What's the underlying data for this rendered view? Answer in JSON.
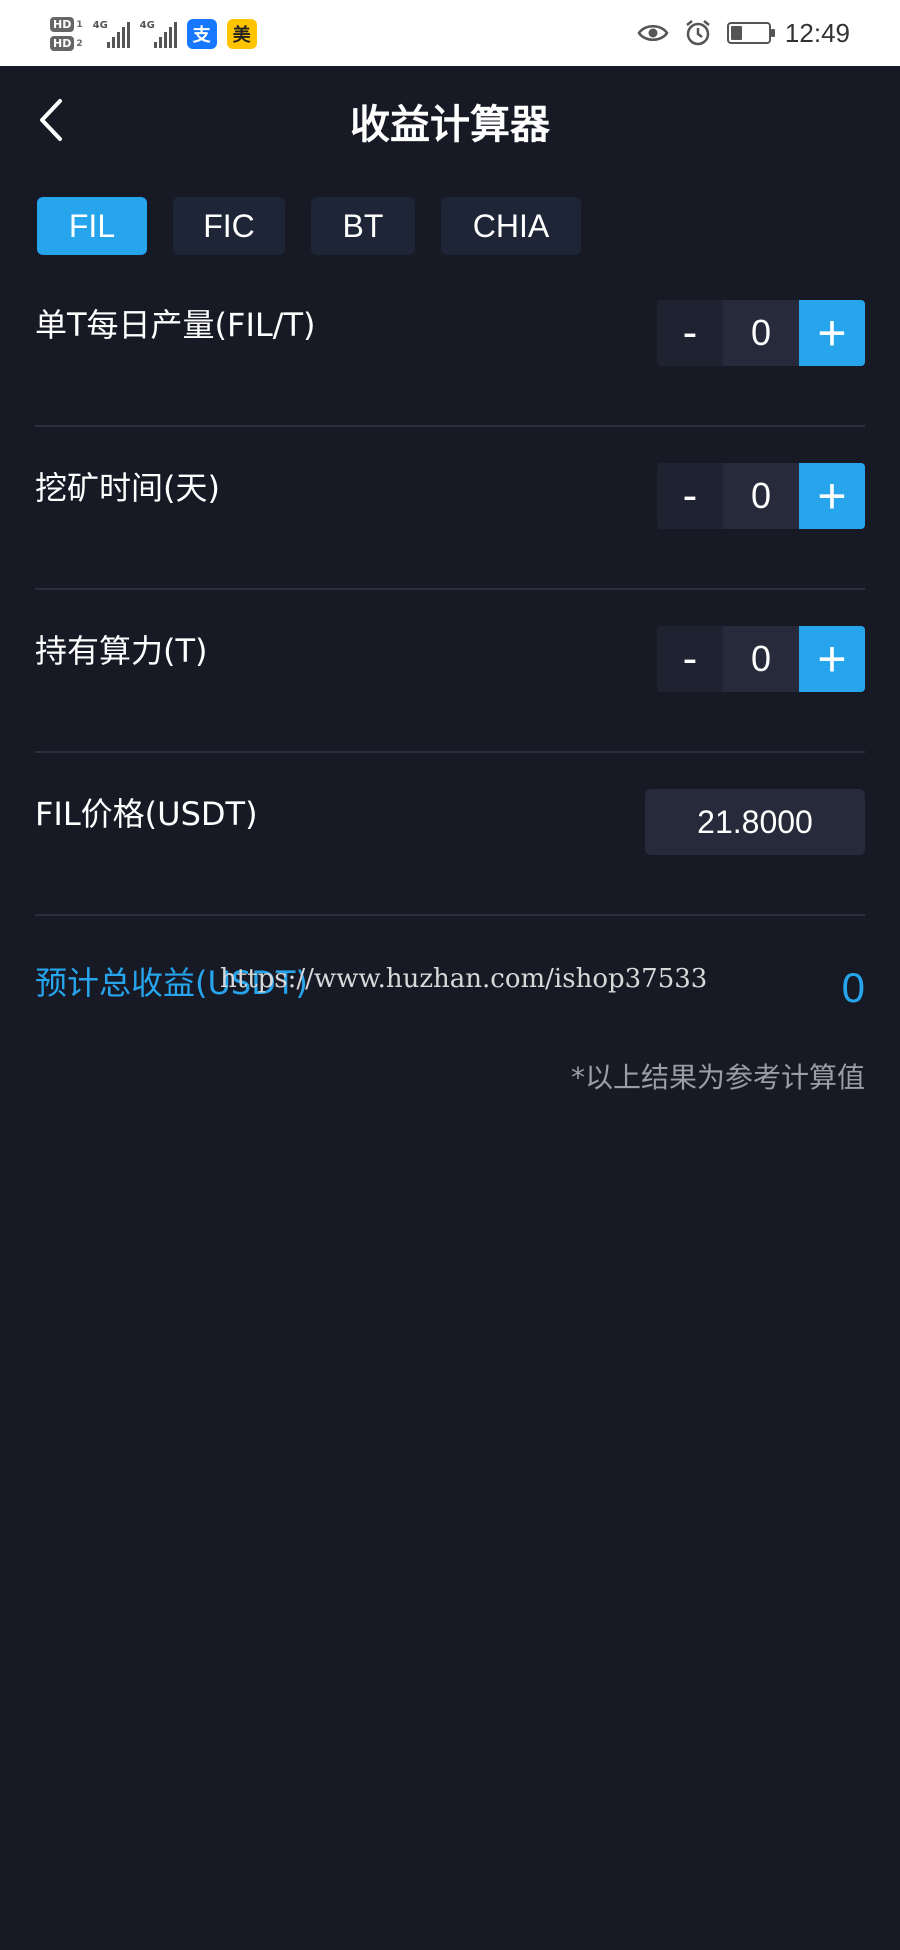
{
  "status_bar": {
    "hd1": "HD",
    "hd1_num": "1",
    "hd2": "HD",
    "hd2_num": "2",
    "net1": "4G",
    "net2": "4G",
    "alipay_glyph": "支",
    "meituan_glyph": "美",
    "time": "12:49",
    "battery_level": 0.3,
    "icons": [
      "eye-icon",
      "alarm-icon",
      "battery-icon"
    ]
  },
  "header": {
    "title": "收益计算器",
    "back_icon": "chevron-left-icon"
  },
  "tabs": [
    {
      "label": "FIL",
      "active": true
    },
    {
      "label": "FIC",
      "active": false
    },
    {
      "label": "BT",
      "active": false
    },
    {
      "label": "CHIA",
      "active": false
    }
  ],
  "rows": [
    {
      "label": "单T每日产量(FIL/T)",
      "minus": "-",
      "value": "0",
      "plus": "+"
    },
    {
      "label": "挖矿时间(天)",
      "minus": "-",
      "value": "0",
      "plus": "+"
    },
    {
      "label": "持有算力(T)",
      "minus": "-",
      "value": "0",
      "plus": "+"
    }
  ],
  "price": {
    "label": "FIL价格(USDT)",
    "value": "21.8000"
  },
  "result": {
    "label": "预计总收益(USDT)",
    "value": "0"
  },
  "watermark": "https://www.huzhan.com/ishop37533",
  "note": "*以上结果为参考计算值",
  "colors": {
    "background": "#171925",
    "accent": "#26a4ec",
    "tab_inactive": "#1d2536",
    "input_bg": "#262a3a"
  }
}
